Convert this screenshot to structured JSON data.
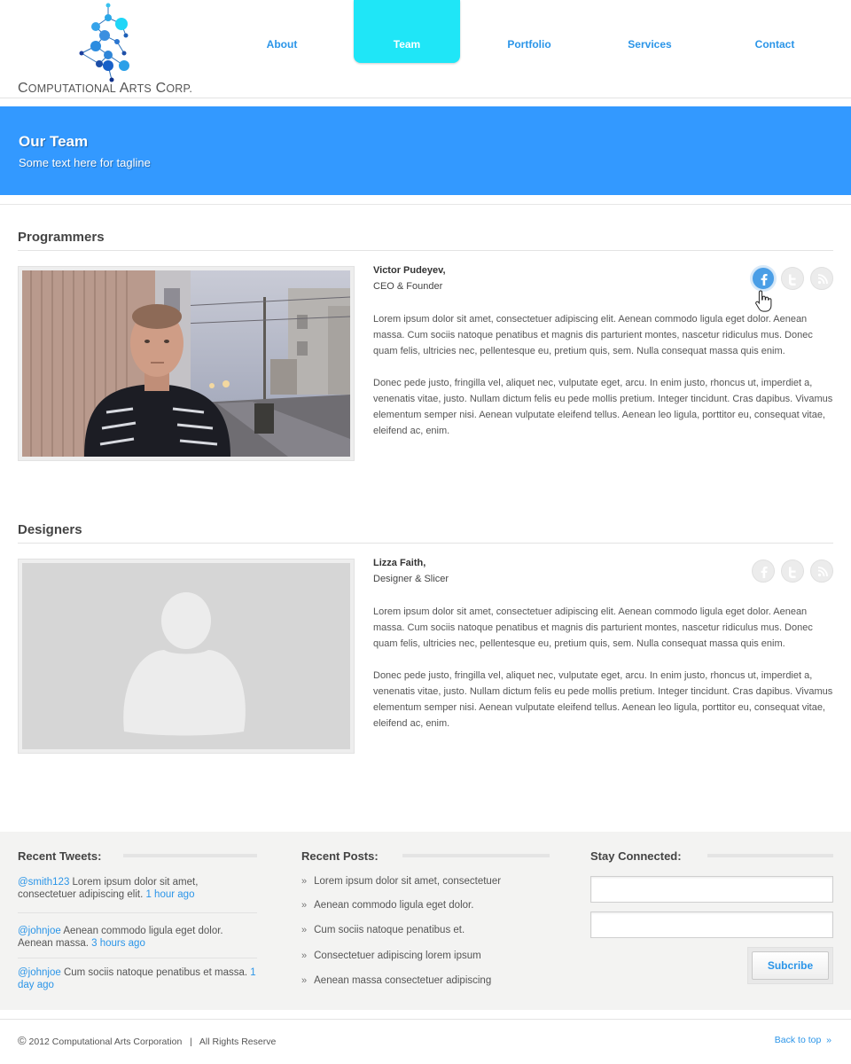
{
  "brand": {
    "name_first": "C",
    "name_rest1": "OMPUTATIONAL",
    "name_a": " A",
    "name_rest2": "RTS",
    "name_c": " C",
    "name_rest3": "ORP."
  },
  "nav": {
    "about": "About",
    "team": "Team",
    "portfolio": "Portfolio",
    "services": "Services",
    "contact": "Contact"
  },
  "banner": {
    "title": "Our Team",
    "tagline": "Some text here for tagline"
  },
  "sections": {
    "programmers": {
      "title": "Programmers",
      "member": {
        "name": "Victor Pudeyev,",
        "role": "CEO & Founder",
        "bio1": "Lorem ipsum dolor sit amet, consectetuer adipiscing elit. Aenean commodo ligula eget dolor. Aenean massa. Cum sociis natoque penatibus et magnis dis parturient montes, nascetur ridiculus mus. Donec quam felis, ultricies nec, pellentesque eu, pretium quis, sem. Nulla consequat massa quis enim.",
        "bio2": "Donec pede justo, fringilla vel, aliquet nec, vulputate eget, arcu. In enim justo, rhoncus ut, imperdiet a, venenatis vitae, justo. Nullam dictum felis eu pede mollis pretium. Integer tincidunt. Cras dapibus. Vivamus elementum semper nisi. Aenean vulputate eleifend tellus. Aenean leo ligula, porttitor eu, consequat vitae, eleifend ac, enim."
      }
    },
    "designers": {
      "title": "Designers",
      "member": {
        "name": "Lizza Faith,",
        "role": "Designer & Slicer",
        "bio1": "Lorem ipsum dolor sit amet, consectetuer adipiscing elit. Aenean commodo ligula eget dolor. Aenean massa. Cum sociis natoque penatibus et magnis dis parturient montes, nascetur ridiculus mus. Donec quam felis, ultricies nec, pellentesque eu, pretium quis, sem. Nulla consequat massa quis enim.",
        "bio2": "Donec pede justo, fringilla vel, aliquet nec, vulputate eget, arcu. In enim justo, rhoncus ut, imperdiet a, venenatis vitae, justo. Nullam dictum felis eu pede mollis pretium. Integer tincidunt. Cras dapibus. Vivamus elementum semper nisi. Aenean vulputate eleifend tellus. Aenean leo ligula, porttitor eu, consequat vitae, eleifend ac, enim."
      }
    }
  },
  "footer": {
    "tweets_title": "Recent Tweets:",
    "tweets": [
      {
        "handle": "@smith123",
        "text": " Lorem ipsum dolor sit amet, consectetuer adipiscing elit. ",
        "ago": "1 hour ago"
      },
      {
        "handle": "@johnjoe",
        "text": " Aenean commodo ligula eget dolor. Aenean massa. ",
        "ago": "3 hours ago"
      },
      {
        "handle": "@johnjoe",
        "text": " Cum sociis natoque penatibus et massa. ",
        "ago": "1 day ago"
      }
    ],
    "posts_title": "Recent Posts:",
    "posts": [
      "Lorem ipsum dolor sit amet, consectetuer",
      "Aenean commodo ligula eget dolor.",
      "Cum sociis natoque penatibus et.",
      "Consectetuer adipiscing lorem ipsum",
      "Aenean massa consectetuer adipiscing"
    ],
    "post_bullet": "»",
    "connect_title": "Stay Connected:",
    "subscribe_label": "Subcribe"
  },
  "bottom": {
    "copyright_symbol": "©",
    "copyright": " 2012 Computational Arts Corporation   |   All Rights Reserve",
    "back_to_top": "Back to top  »"
  },
  "icons": {
    "facebook": "facebook-icon",
    "twitter": "twitter-icon",
    "rss": "rss-icon",
    "cursor": "hand-cursor-icon",
    "logo": "molecule-logo-icon"
  },
  "colors": {
    "accent": "#3399ff",
    "nav_active": "#1fe6f7",
    "link": "#2b95e8"
  }
}
